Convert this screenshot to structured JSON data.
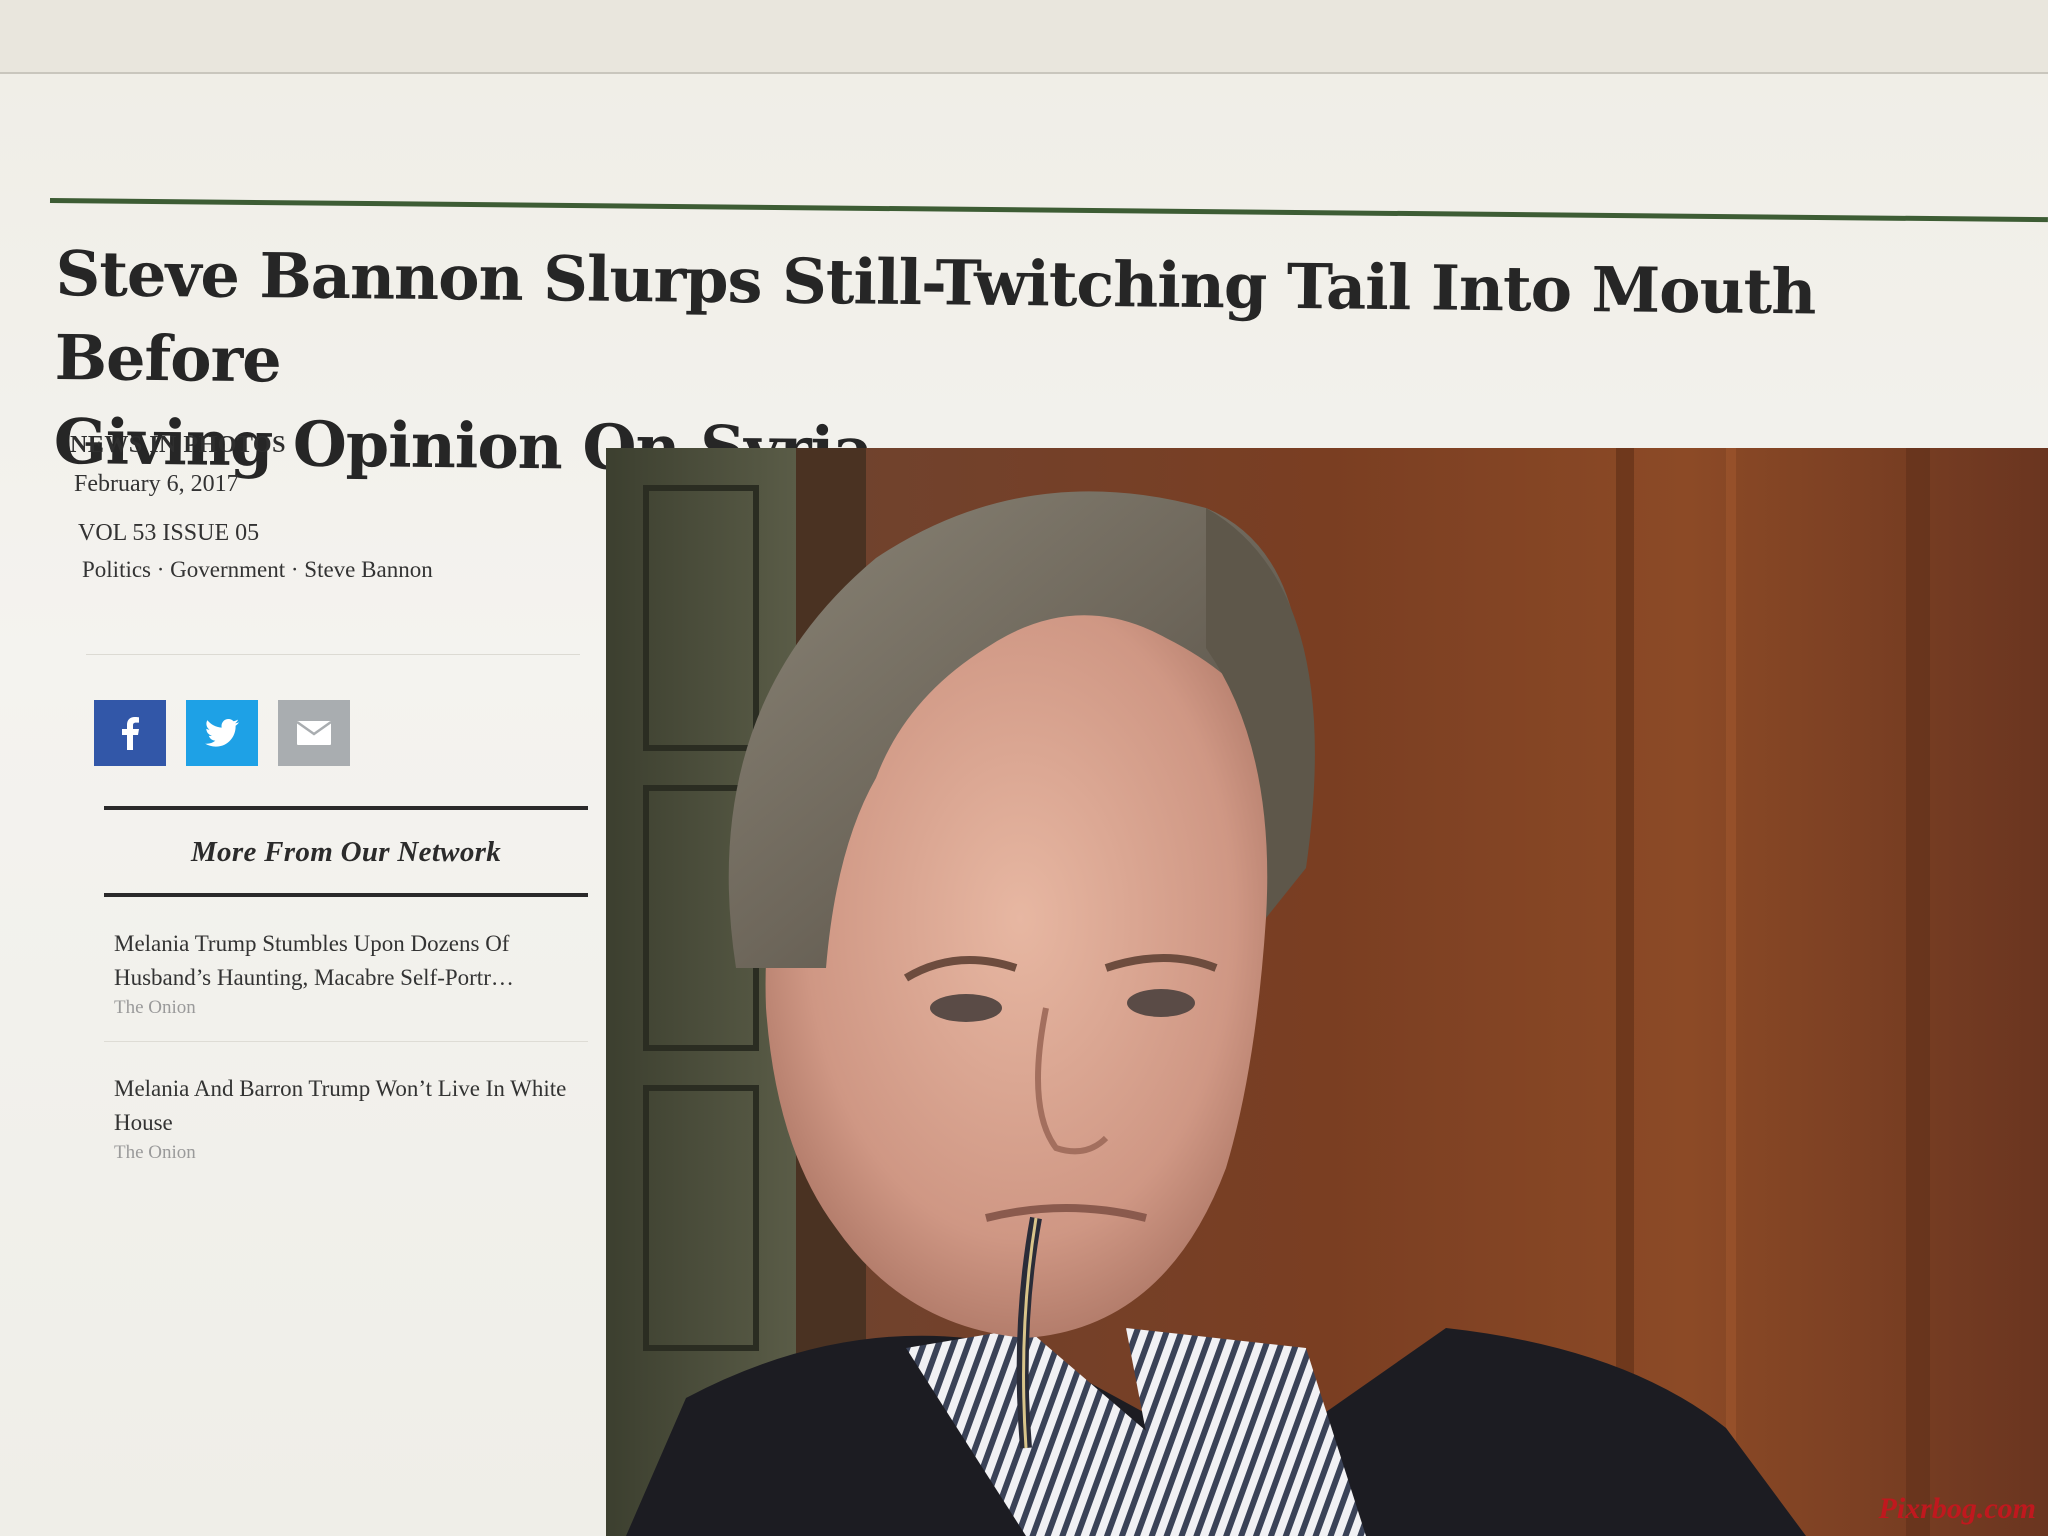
{
  "article": {
    "headline_line1": "Steve Bannon Slurps Still-Twitching Tail Into Mouth Before",
    "headline_line2": "Giving Opinion On Syria",
    "section": "NEWS IN PHOTOS",
    "date": "February 6, 2017",
    "volume": "VOL 53 ISSUE 05",
    "tags": "Politics · Government · Steve Bannon"
  },
  "share": {
    "buttons": [
      {
        "icon": "facebook-icon",
        "color": "#3257a8"
      },
      {
        "icon": "twitter-icon",
        "color": "#1ea1e6"
      },
      {
        "icon": "email-icon",
        "color": "#a9adb0"
      }
    ]
  },
  "network": {
    "title": "More From Our Network",
    "items": [
      {
        "headline": "Melania Trump Stumbles Upon Dozens Of Husband’s Haunting, Macabre Self-Portr…",
        "source": "The Onion"
      },
      {
        "headline": "Melania And Barron Trump Won’t Live In White House",
        "source": "The Onion"
      }
    ]
  },
  "photo": {
    "watermark": "Pixrbog.com"
  },
  "colors": {
    "accent_rule": "#3d5c34",
    "watermark": "#c0181e"
  }
}
